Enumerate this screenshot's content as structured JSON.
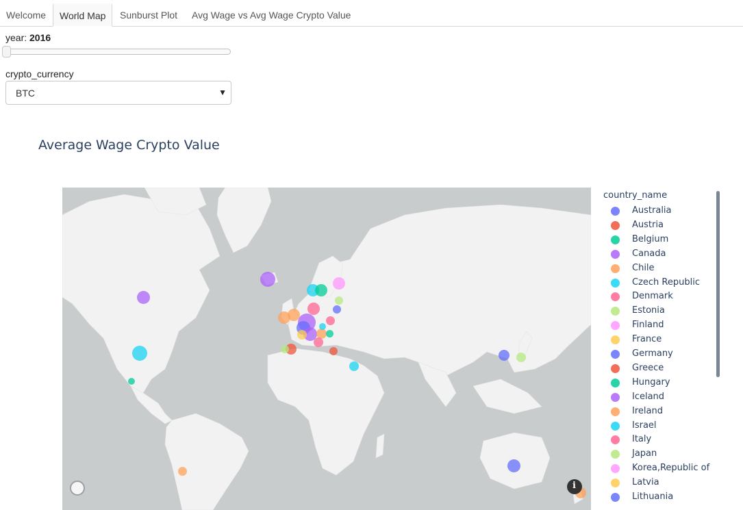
{
  "tabs": [
    {
      "label": "Welcome",
      "active": false
    },
    {
      "label": "World Map",
      "active": true
    },
    {
      "label": "Sunburst Plot",
      "active": false
    },
    {
      "label": "Avg Wage vs Avg Wage Crypto Value",
      "active": false
    }
  ],
  "year_control": {
    "label": "year: ",
    "value": "2016"
  },
  "crypto_control": {
    "label": "crypto_currency",
    "value": "BTC"
  },
  "chart": {
    "title": "Average Wage Crypto Value",
    "legend_title": "country_name",
    "legend": [
      {
        "name": "Australia",
        "color": "#636efa"
      },
      {
        "name": "Austria",
        "color": "#ef553b"
      },
      {
        "name": "Belgium",
        "color": "#00cc96"
      },
      {
        "name": "Canada",
        "color": "#ab63fa"
      },
      {
        "name": "Chile",
        "color": "#ffa15a"
      },
      {
        "name": "Czech Republic",
        "color": "#19d3f3"
      },
      {
        "name": "Denmark",
        "color": "#ff6692"
      },
      {
        "name": "Estonia",
        "color": "#b6e880"
      },
      {
        "name": "Finland",
        "color": "#ff97ff"
      },
      {
        "name": "France",
        "color": "#fecb52"
      },
      {
        "name": "Germany",
        "color": "#636efa"
      },
      {
        "name": "Greece",
        "color": "#ef553b"
      },
      {
        "name": "Hungary",
        "color": "#00cc96"
      },
      {
        "name": "Iceland",
        "color": "#ab63fa"
      },
      {
        "name": "Ireland",
        "color": "#ffa15a"
      },
      {
        "name": "Israel",
        "color": "#19d3f3"
      },
      {
        "name": "Italy",
        "color": "#ff6692"
      },
      {
        "name": "Japan",
        "color": "#b6e880"
      },
      {
        "name": "Korea,Republic of",
        "color": "#ff97ff"
      },
      {
        "name": "Latvia",
        "color": "#fecb52"
      },
      {
        "name": "Lithuania",
        "color": "#636efa"
      }
    ]
  }
}
